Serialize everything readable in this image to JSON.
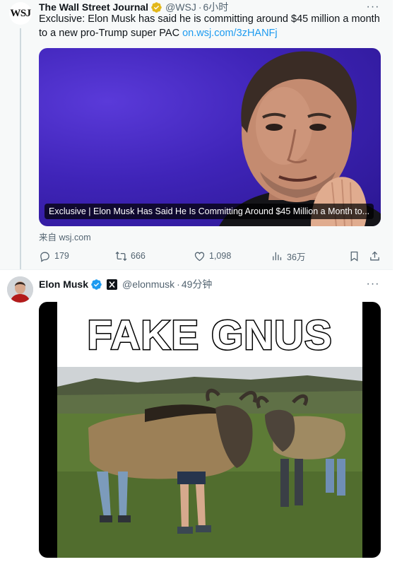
{
  "tweets": [
    {
      "author": {
        "name": "The Wall Street Journal",
        "handle": "@WSJ",
        "time": "6小时",
        "avatar_text": "WSJ",
        "verified": "gold"
      },
      "text": "Exclusive: Elon Musk has said he is committing around $45 million a month to a new pro-Trump super PAC ",
      "link": "on.wsj.com/3zHANFj",
      "card": {
        "caption": "Exclusive | Elon Musk Has Said He Is Committing Around $45 Million a Month to..."
      },
      "source": "来自 wsj.com",
      "stats": {
        "replies": "179",
        "retweets": "666",
        "likes": "1,098",
        "views": "36万"
      }
    },
    {
      "author": {
        "name": "Elon Musk",
        "handle": "@elonmusk",
        "time": "49分钟",
        "verified": "blue",
        "affiliate": "x-logo"
      },
      "meme": {
        "title": "FAKE GNUS"
      }
    }
  ],
  "icons": [
    "more-icon",
    "verified-gold-icon",
    "verified-blue-icon",
    "x-logo-icon",
    "reply-icon",
    "retweet-icon",
    "like-icon",
    "views-icon",
    "bookmark-icon",
    "share-icon"
  ],
  "colors": {
    "link": "#1d9bf0",
    "muted": "#536471",
    "gold": "#e2b719",
    "blue": "#1d9bf0",
    "card_bg": "#3f24b8"
  }
}
